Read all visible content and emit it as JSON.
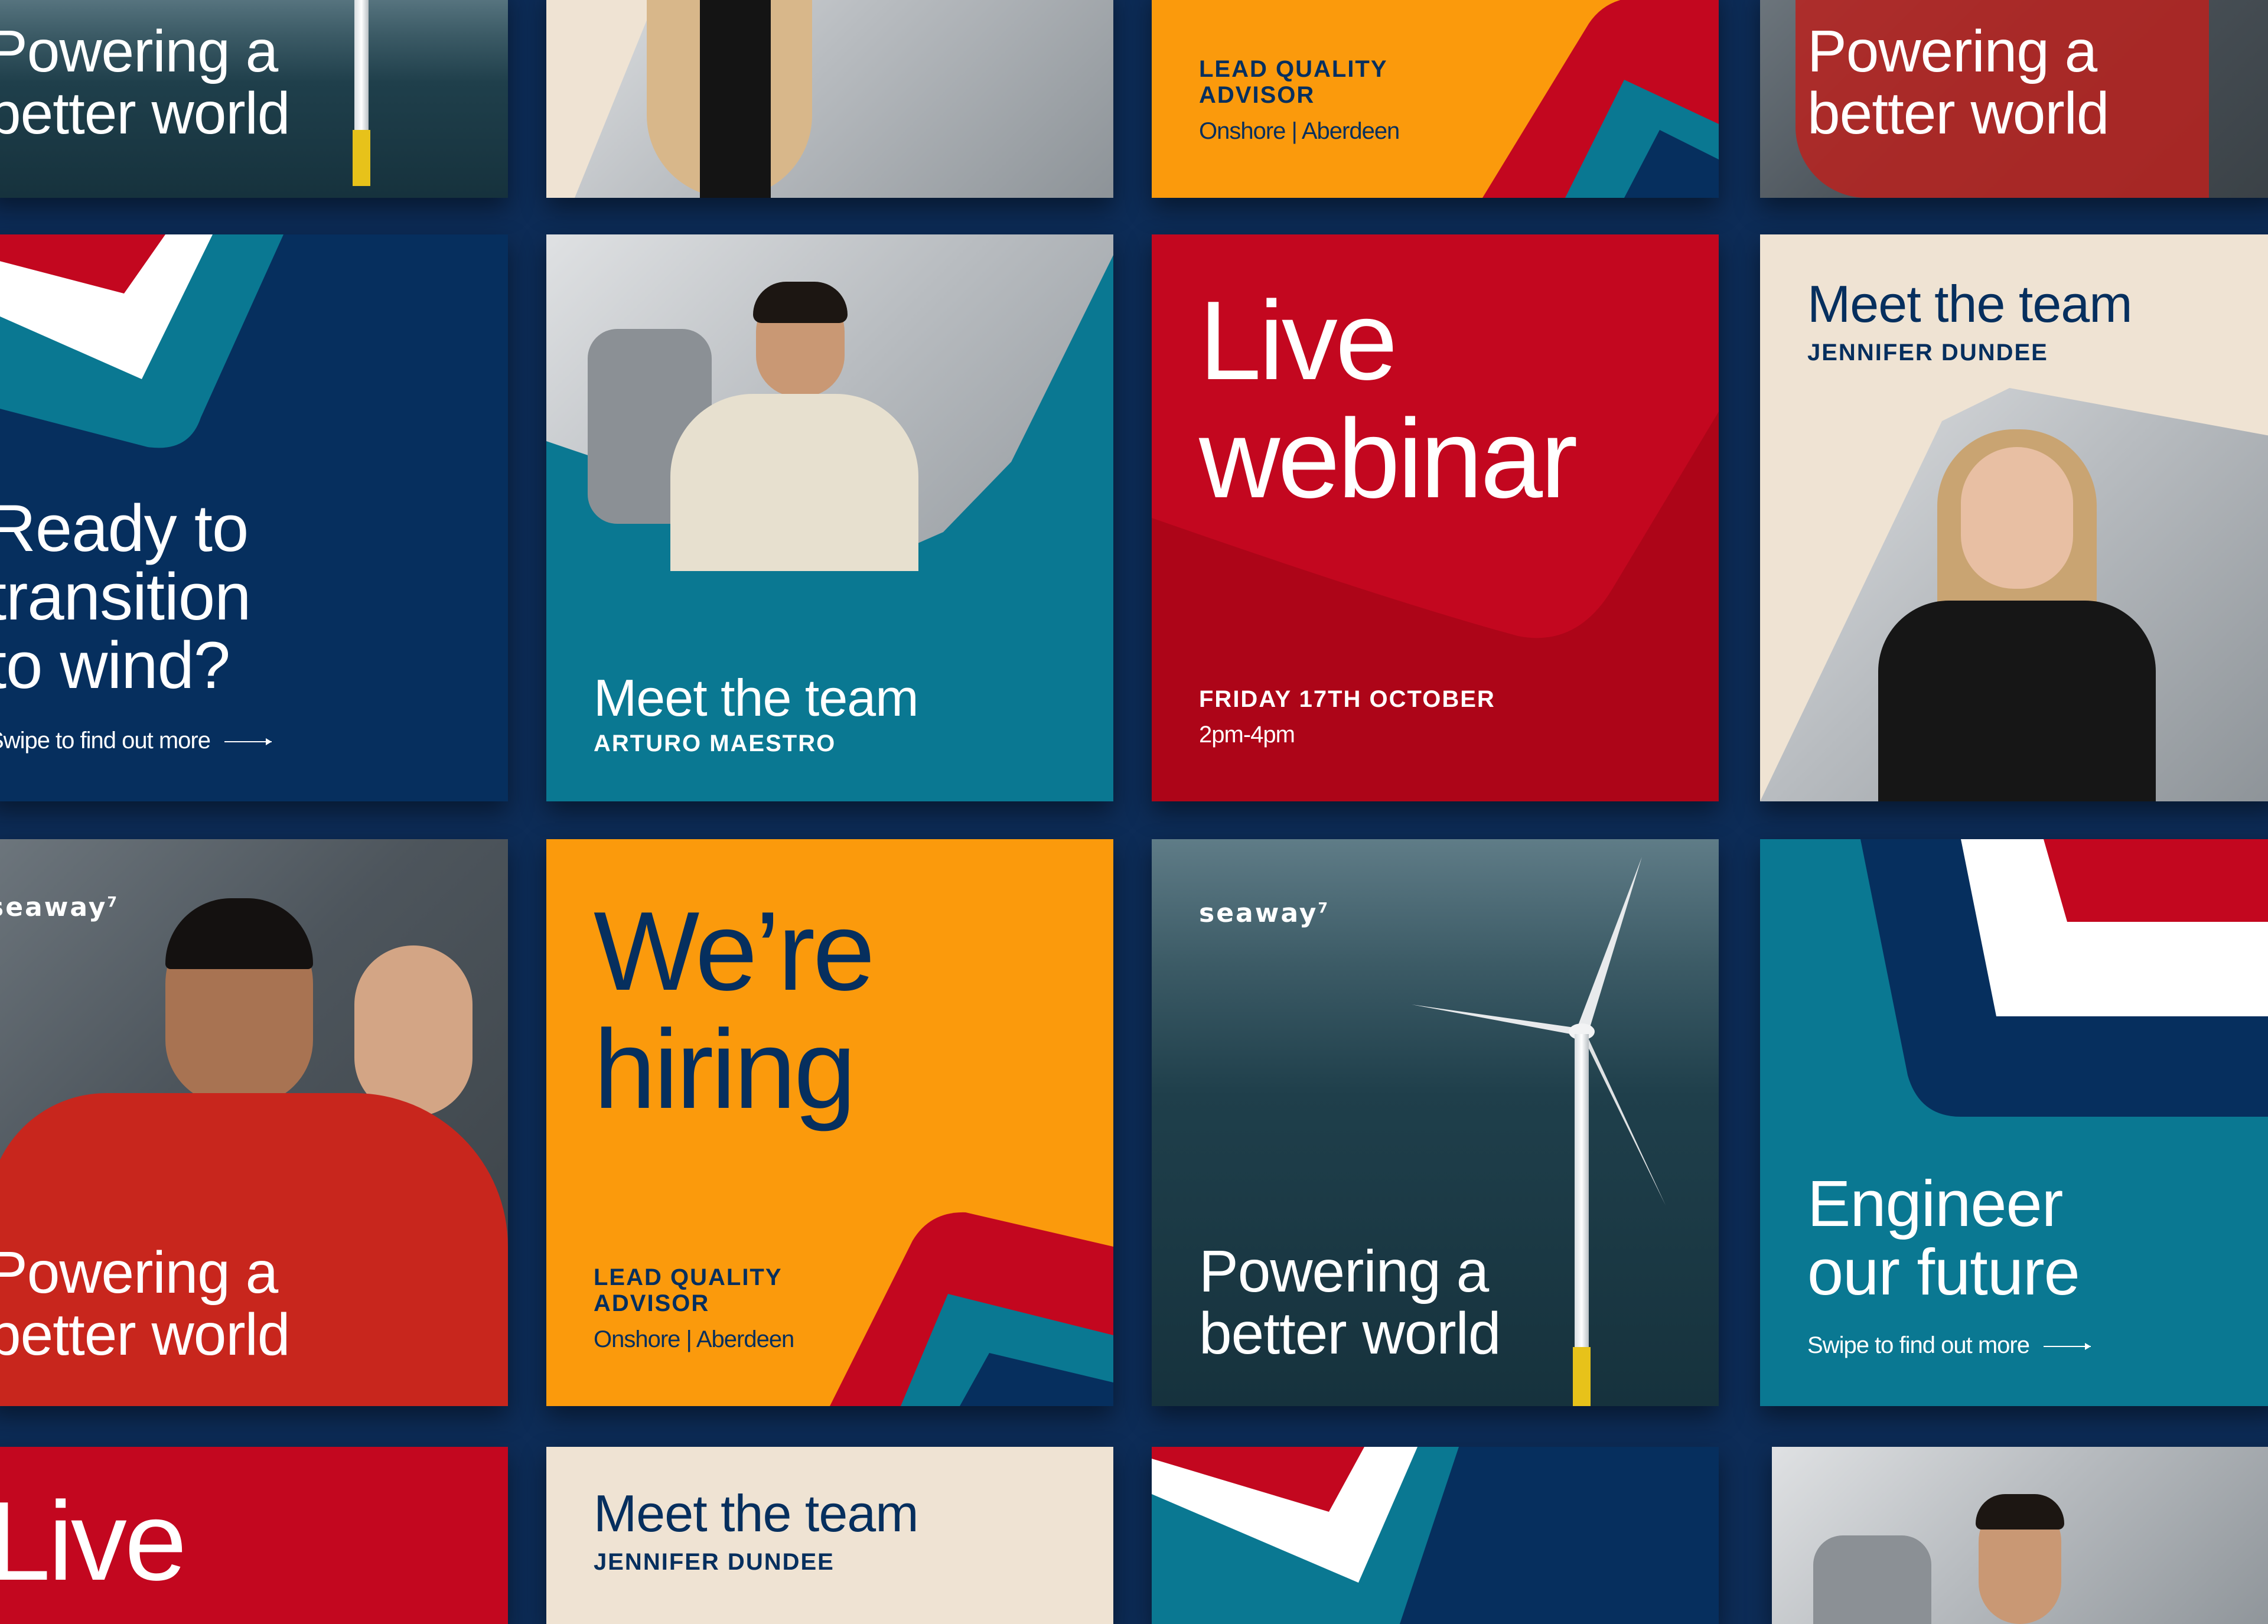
{
  "tiles": {
    "r1c1": {
      "headline": "Powering a better world"
    },
    "r1c3": {
      "role": "LEAD QUALITY ADVISOR",
      "location": "Onshore | Aberdeen"
    },
    "r1c4": {
      "headline": "Powering a better world"
    },
    "r2c1": {
      "headline": "Ready to transition to wind?",
      "cta": "Swipe to find out more"
    },
    "r2c2": {
      "title": "Meet the team",
      "name": "ARTURO MAESTRO"
    },
    "r2c3": {
      "headline": "Live webinar",
      "date": "FRIDAY 17TH OCTOBER",
      "time": "2pm-4pm"
    },
    "r2c4": {
      "title": "Meet the team",
      "name": "JENNIFER DUNDEE"
    },
    "r3c1": {
      "logo": "seaway",
      "logo_mark": "7",
      "headline": "Powering a better world"
    },
    "r3c2": {
      "headline": "We’re hiring",
      "role": "LEAD QUALITY ADVISOR",
      "location": "Onshore | Aberdeen"
    },
    "r3c3": {
      "logo": "seaway",
      "logo_mark": "7",
      "headline": "Powering a better world"
    },
    "r3c4": {
      "headline": "Engineer our future",
      "cta": "Swipe to find out more"
    },
    "r4c1": {
      "headline": "Live"
    },
    "r4c2": {
      "title": "Meet the team",
      "name": "JENNIFER DUNDEE"
    }
  },
  "colors": {
    "navy": "#062f5e",
    "teal": "#0a7892",
    "red": "#c3071f",
    "orange": "#fb9a0c",
    "cream": "#efe3d3",
    "background": "#0d2c57"
  }
}
